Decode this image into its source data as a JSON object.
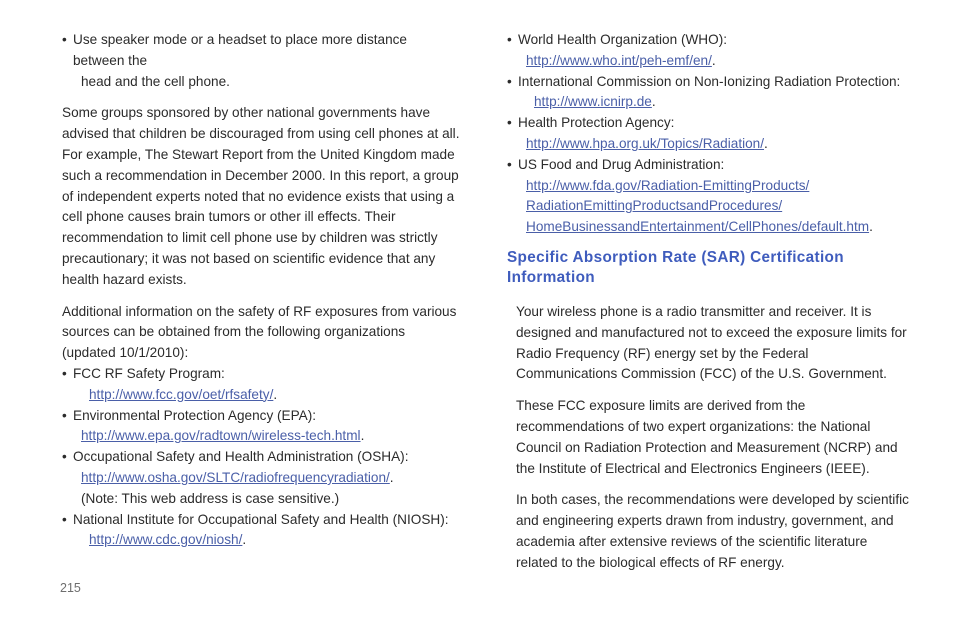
{
  "page": {
    "number": "215",
    "heading_color": "#3f5cbd",
    "link_color": "#4a5fa8",
    "body_color": "#2b2b2b"
  },
  "left_column": {
    "top_bullets": [
      {
        "text": "Use speaker mode or a headset to place more distance between the",
        "cont": "head and the cell phone."
      }
    ],
    "paragraph_1": "Some groups sponsored by other national governments have advised that children be discouraged from using cell phones at all. For example, The Stewart Report from the United Kingdom made such a recommendation in December 2000. In this report, a group of independent experts noted that no evidence exists that using a cell phone causes brain tumors or other ill effects. Their recommendation to limit cell phone use by children was strictly precautionary; it was not based on scientific evidence that any health hazard exists.",
    "paragraph_2": "Additional information on the safety of RF exposures from various sources can be obtained from the following organizations (updated 10/1/2010):",
    "org_bullets": [
      {
        "label": "FCC RF Safety Program:",
        "url": "http://www.fcc.gov/oet/rfsafety/",
        "url_indent": "deep",
        "note": ""
      },
      {
        "label": "Environmental Protection Agency (EPA):",
        "url": "http://www.epa.gov/radtown/wireless-tech.html",
        "url_indent": "normal",
        "note": ""
      },
      {
        "label": "Occupational Safety and Health Administration (OSHA):",
        "url": "http://www.osha.gov/SLTC/radiofrequencyradiation/",
        "url_indent": "normal",
        "note": "(Note: This web address is case sensitive.)"
      },
      {
        "label": "National Institute for Occupational Safety and Health (NIOSH):",
        "url": "http://www.cdc.gov/niosh/",
        "url_indent": "deep",
        "note": ""
      }
    ]
  },
  "right_column": {
    "org_bullets": [
      {
        "label": "World Health Organization (WHO):",
        "url_lines": [
          "http://www.who.int/peh-emf/en/"
        ],
        "url_indent": "normal"
      },
      {
        "label": "International Commission on Non-Ionizing Radiation Protection:",
        "url_lines": [
          "http://www.icnirp.de"
        ],
        "url_indent": "deep"
      },
      {
        "label": "Health Protection Agency:",
        "url_lines": [
          "http://www.hpa.org.uk/Topics/Radiation/"
        ],
        "url_indent": "normal"
      },
      {
        "label": "US Food and Drug Administration:",
        "url_lines": [
          "http://www.fda.gov/Radiation-EmittingProducts/",
          "RadiationEmittingProductsandProcedures/",
          "HomeBusinessandEntertainment/CellPhones/default.htm"
        ],
        "url_indent": "normal"
      }
    ],
    "section_heading": "Specific Absorption Rate (SAR) Certification Information",
    "paragraphs": [
      "Your wireless phone is a radio transmitter and receiver. It is designed and manufactured not to exceed the exposure limits for Radio Frequency (RF) energy set by the Federal Communications Commission (FCC) of the U.S. Government.",
      "These FCC exposure limits are derived from the recommendations of two expert organizations: the National Council on Radiation Protection and Measurement (NCRP) and the Institute of Electrical and Electronics Engineers (IEEE).",
      "In both cases, the recommendations were developed by scientific and engineering experts drawn from industry, government, and academia after extensive reviews of the scientific literature related to the biological effects of RF energy."
    ]
  }
}
